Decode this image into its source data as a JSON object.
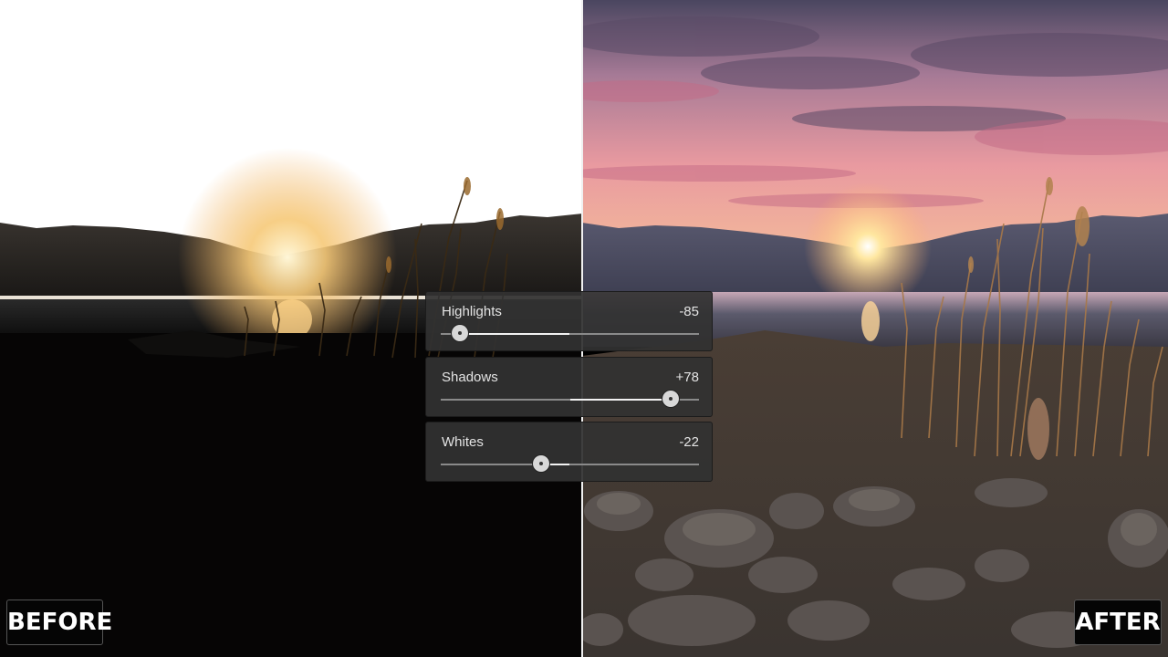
{
  "labels": {
    "before": "BEFORE",
    "after": "AFTER"
  },
  "adjustments": [
    {
      "name": "Highlights",
      "value_text": "-85",
      "value": -85
    },
    {
      "name": "Shadows",
      "value_text": "+78",
      "value": 78
    },
    {
      "name": "Whites",
      "value_text": "-22",
      "value": -22
    }
  ],
  "colors": {
    "panel": "#323232",
    "track": "#8a8a8a",
    "fill": "#f2f2f2",
    "thumb": "#d8d8d8"
  },
  "icons": {
    "slider_thumb": "circle-dot-icon"
  }
}
